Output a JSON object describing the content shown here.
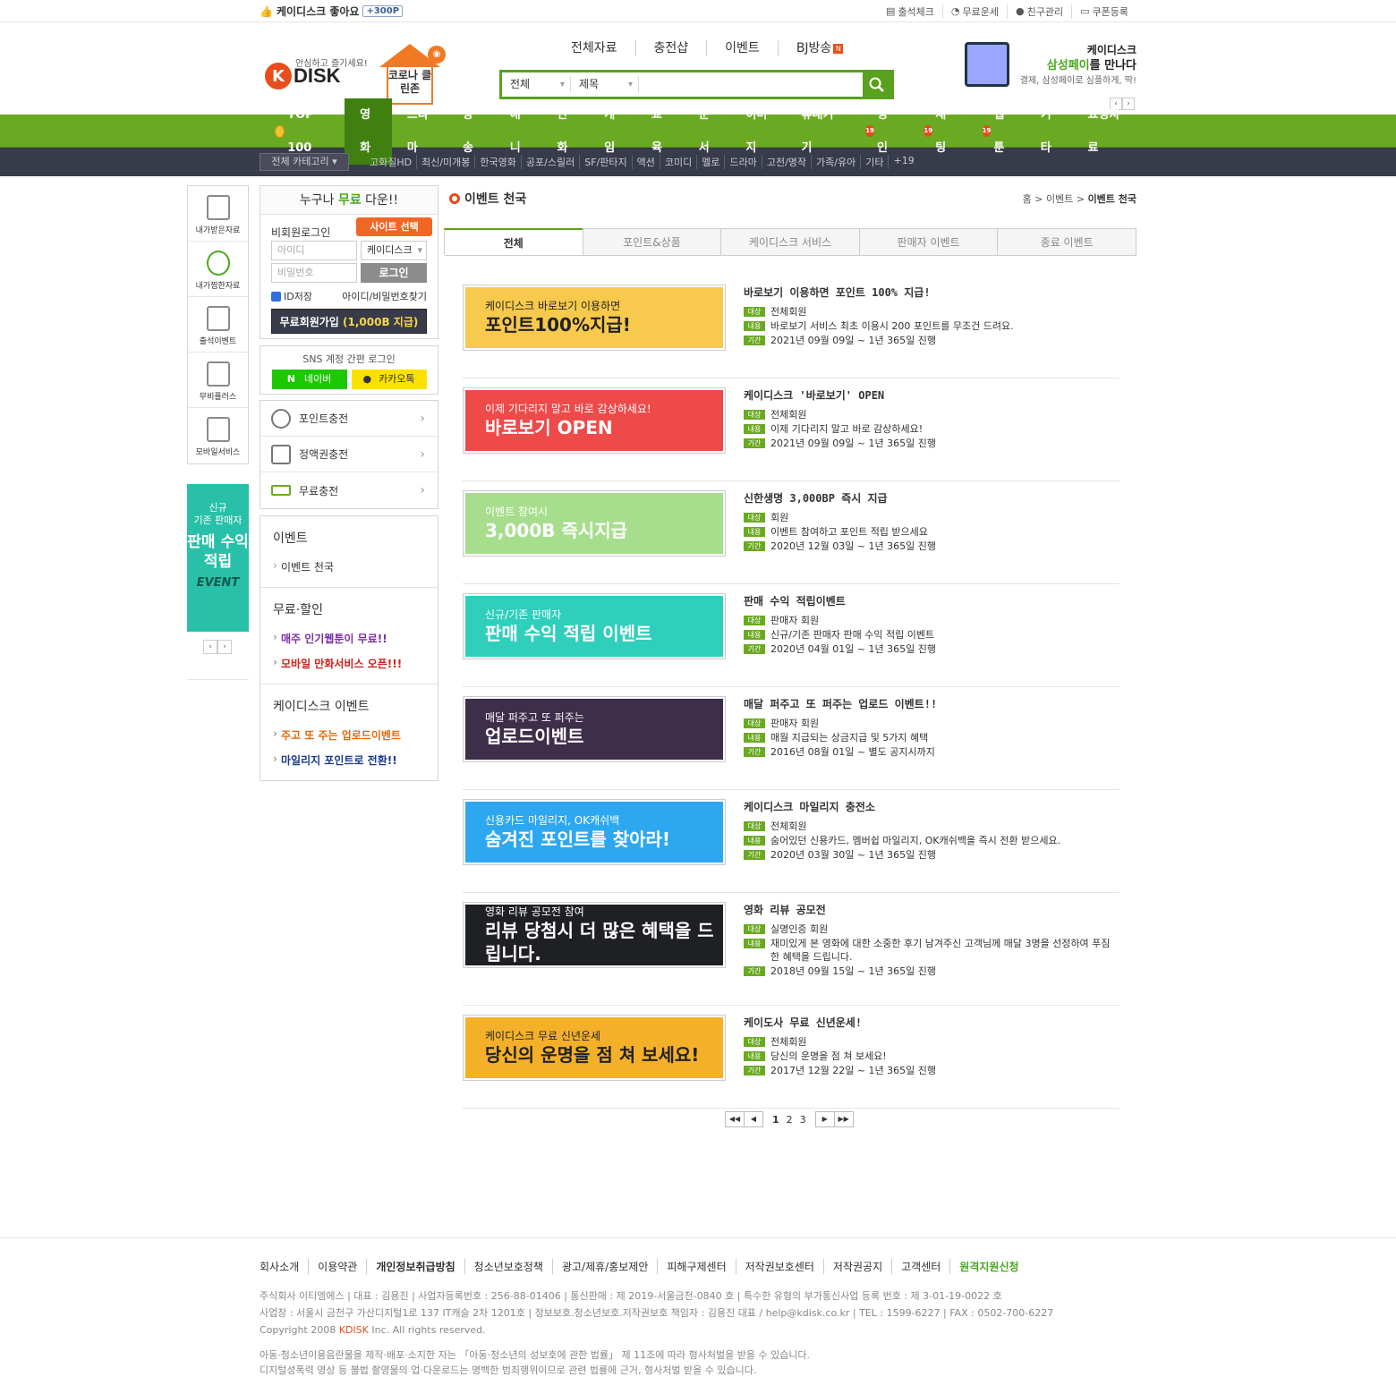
{
  "topbar": {
    "like_text": "케이디스크 좋아요",
    "like_points": "+300P",
    "links": [
      "출석체크",
      "무료운세",
      "친구관리",
      "쿠폰등록"
    ]
  },
  "header": {
    "logo_text": "DISK",
    "logo_k": "K",
    "slogan": "안심하고 즐기세요!",
    "corona_title": "코로나 클린존",
    "nav": [
      "전체자료",
      "충전샵",
      "이벤트",
      "BJ방송"
    ],
    "nav_badge": "N",
    "search": {
      "category": "전체",
      "field": "제목",
      "placeholder": ""
    },
    "promo": {
      "line1": "케이디스크",
      "line2_brand": "삼성페이",
      "line2_rest": "를 만나다",
      "line3": "결제, 삼성페이로 심플하게, 딱!"
    }
  },
  "gnb": [
    "TOP 100",
    "영화",
    "드라마",
    "방송",
    "애니",
    "만화",
    "게임",
    "교육",
    "문서",
    "이미지",
    "휴대기기",
    "성인",
    "채팅",
    "웹툰",
    "기타",
    "요청자료"
  ],
  "gnb_active": "영화",
  "gnb_adult_badge": "19",
  "subnav": {
    "category_select": "전체 카테고리",
    "items": [
      "고화질HD",
      "최신/미개봉",
      "한국영화",
      "공포/스릴러",
      "SF/판타지",
      "액션",
      "코미디",
      "멜로",
      "드라마",
      "고전/명작",
      "가족/유아",
      "기타",
      "+19"
    ]
  },
  "quick": {
    "items": [
      "내가받은자료",
      "내가찜한자료",
      "출석이벤트",
      "무비플러스",
      "모바일서비스"
    ],
    "banner": {
      "line1": "신규",
      "line2": "기존 판매자",
      "big": "판매 수익 적립",
      "tag": "EVENT"
    }
  },
  "login": {
    "title_pre": "누구나 ",
    "title_hl": "무료",
    "title_post": " 다운!!",
    "label": "비회원로그인",
    "site_button": "사이트 선택",
    "id_placeholder": "아이디",
    "pw_placeholder": "비밀번호",
    "site_value": "케이디스크",
    "login_button": "로그인",
    "save_id": "ID저장",
    "find": "아이디/비밀번호찾기",
    "join_pre": "무료회원가입 ",
    "join_hl": "(1,000B 지급)"
  },
  "sns": {
    "title": "SNS 계정 간편 로그인",
    "naver": "네이버",
    "kakao": "카카오톡"
  },
  "charge": [
    "포인트충전",
    "정액권충전",
    "무료충전"
  ],
  "catbox": [
    {
      "title": "이벤트",
      "items": [
        {
          "label": "이벤트 천국",
          "color": "#333333"
        }
      ]
    },
    {
      "title": "무료·할인",
      "items": [
        {
          "label": "매주 인기웹툰이 무료!!",
          "color": "#7b2fa8"
        },
        {
          "label": "모바일 만화서비스 오픈!!!",
          "color": "#d0201a"
        }
      ]
    },
    {
      "title": "케이디스크 이벤트",
      "items": [
        {
          "label": "주고 또 주는 업로드이벤트",
          "color": "#e06a10"
        },
        {
          "label": "마일리지 포인트로 전환!!",
          "color": "#1a3a8a"
        }
      ]
    }
  ],
  "content": {
    "title": "이벤트 천국",
    "breadcrumb": [
      "홈",
      "이벤트",
      "이벤트 천국"
    ],
    "tabs": [
      "전체",
      "포인트&상품",
      "케이디스크 서비스",
      "판매자 이벤트",
      "종료 이벤트"
    ],
    "row_labels": {
      "target": "대상",
      "content": "내용",
      "period": "기간"
    },
    "events": [
      {
        "title": "바로보기 이용하면 포인트 100% 지급!",
        "target": "전체회원",
        "desc": "바로보기 서비스 최초 이용시 200 포인트를 무조건 드려요.",
        "period": "2021년 09월 09일 ~ 1년 365일 진행",
        "thumb_l1": "케이디스크 바로보기 이용하면",
        "thumb_l2": "포인트100%지급!",
        "thumb_bg": "#f7c94c",
        "thumb_fg": "#222222"
      },
      {
        "title": "케이디스크 '바로보기' OPEN",
        "target": "전체회원",
        "desc": "이제 기다리지 말고 바로 감상하세요!",
        "period": "2021년 09월 09일 ~ 1년 365일 진행",
        "thumb_l1": "이제 기다리지 말고 바로 감상하세요!",
        "thumb_l2": "바로보기 OPEN",
        "thumb_bg": "#ee4a4a",
        "thumb_fg": "#ffffff"
      },
      {
        "title": "신한생명 3,000BP 즉시 지급",
        "target": "회원",
        "desc": "이벤트 참여하고 포인트 적립 받으세요",
        "period": "2020년 12월 03일 ~ 1년 365일 진행",
        "thumb_l1": "이벤트 참여시",
        "thumb_l2": "3,000B 즉시지급",
        "thumb_bg": "#a7de8e",
        "thumb_fg": "#ffffff"
      },
      {
        "title": "판매 수익 적립이벤트",
        "target": "판매자 회원",
        "desc": "신규/기존 판매자 판매 수익 적립 이벤트",
        "period": "2020년 04월 01일 ~ 1년 365일 진행",
        "thumb_l1": "신규/기존 판매자",
        "thumb_l2": "판매 수익 적립 이벤트",
        "thumb_bg": "#2fcfbc",
        "thumb_fg": "#ffffff"
      },
      {
        "title": "매달 퍼주고 또 퍼주는 업로드 이벤트!!",
        "target": "판매자 회원",
        "desc": "매월 지급되는 상금지급 및 5가지 혜택",
        "period": "2016년 08월 01일 ~ 별도 공지시까지",
        "thumb_l1": "매달 퍼주고 또 퍼주는",
        "thumb_l2": "업로드이벤트",
        "thumb_bg": "#3d2e4a",
        "thumb_fg": "#ffffff"
      },
      {
        "title": "케이디스크 마일리지 충전소",
        "target": "전체회원",
        "desc": "숨어있던 신용카드, 멤버쉽 마일리지, OK캐쉬백을 즉시 전환 받으세요.",
        "period": "2020년 03월 30일 ~ 1년 365일 진행",
        "thumb_l1": "신용카드 마일리지, OK캐쉬백",
        "thumb_l2": "숨겨진 포인트를 찾아라!",
        "thumb_bg": "#2da8f0",
        "thumb_fg": "#ffffff"
      },
      {
        "title": "영화 리뷰 공모전",
        "target": "실명인증 회원",
        "desc": "재미있게 본 영화에 대한 소중한 후기 남겨주신 고객님께 매달 3명을 선정하여 푸짐한 혜택을 드립니다.",
        "period": "2018년 09월 15일 ~ 1년 365일 진행",
        "thumb_l1": "영화 리뷰 공모전 참여",
        "thumb_l2": "리뷰 당첨시 더 많은 혜택을 드립니다.",
        "thumb_bg": "#1f2024",
        "thumb_fg": "#ffffff"
      },
      {
        "title": "케이도사 무료 신년운세!",
        "target": "전체회원",
        "desc": "당신의 운명을 점 쳐 보세요!",
        "period": "2017년 12월 22일 ~ 1년 365일 진행",
        "thumb_l1": "케이디스크 무료 신년운세",
        "thumb_l2": "당신의 운명을 점 쳐 보세요!",
        "thumb_bg": "#f5b02a",
        "thumb_fg": "#222222"
      }
    ],
    "pages": [
      "1",
      "2",
      "3"
    ],
    "current_page": "1"
  },
  "footer": {
    "links": [
      "회사소개",
      "이용약관",
      "개인정보취급방침",
      "청소년보호정책",
      "광고/제휴/홍보제안",
      "피해구제센터",
      "저작권보호센터",
      "저작권공지",
      "고객센터",
      "원격지원신청"
    ],
    "info1": "주식회사 이티엠에스 | 대표 : 김용진 | 사업자등록번호 : 256-88-01406 | 통신판매 : 제 2019-서울금천-0840 호 | 특수한 유형의 부가통신사업 등록 번호 : 제 3-01-19-0022 호",
    "info2": "사업장 : 서울시 금천구 가산디지털1로 137 IT캐슬 2차 1201호 | 정보보호.청소년보호.저작권보호 책임자 : 김용진 대표 / help@kdisk.co.kr | TEL : 1599-6227 | FAX : 0502-700-6227",
    "copyright_pre": "Copyright 2008 ",
    "copyright_brand": "KDISK",
    "copyright_post": " Inc. All rights reserved.",
    "warn1": "아동·청소년이용음란물을 제작·배포·소지한 자는 「아동·청소년의 성보호에 관한 법률」 제 11조에 따라 형사처벌을 받을 수 있습니다.",
    "warn2": "디지털성폭력 영상 등 불법 촬영물의 업·다운로드는 명백한 범죄행위이므로 관련 법률에 근거, 형사처벌 받을 수 있습니다."
  }
}
